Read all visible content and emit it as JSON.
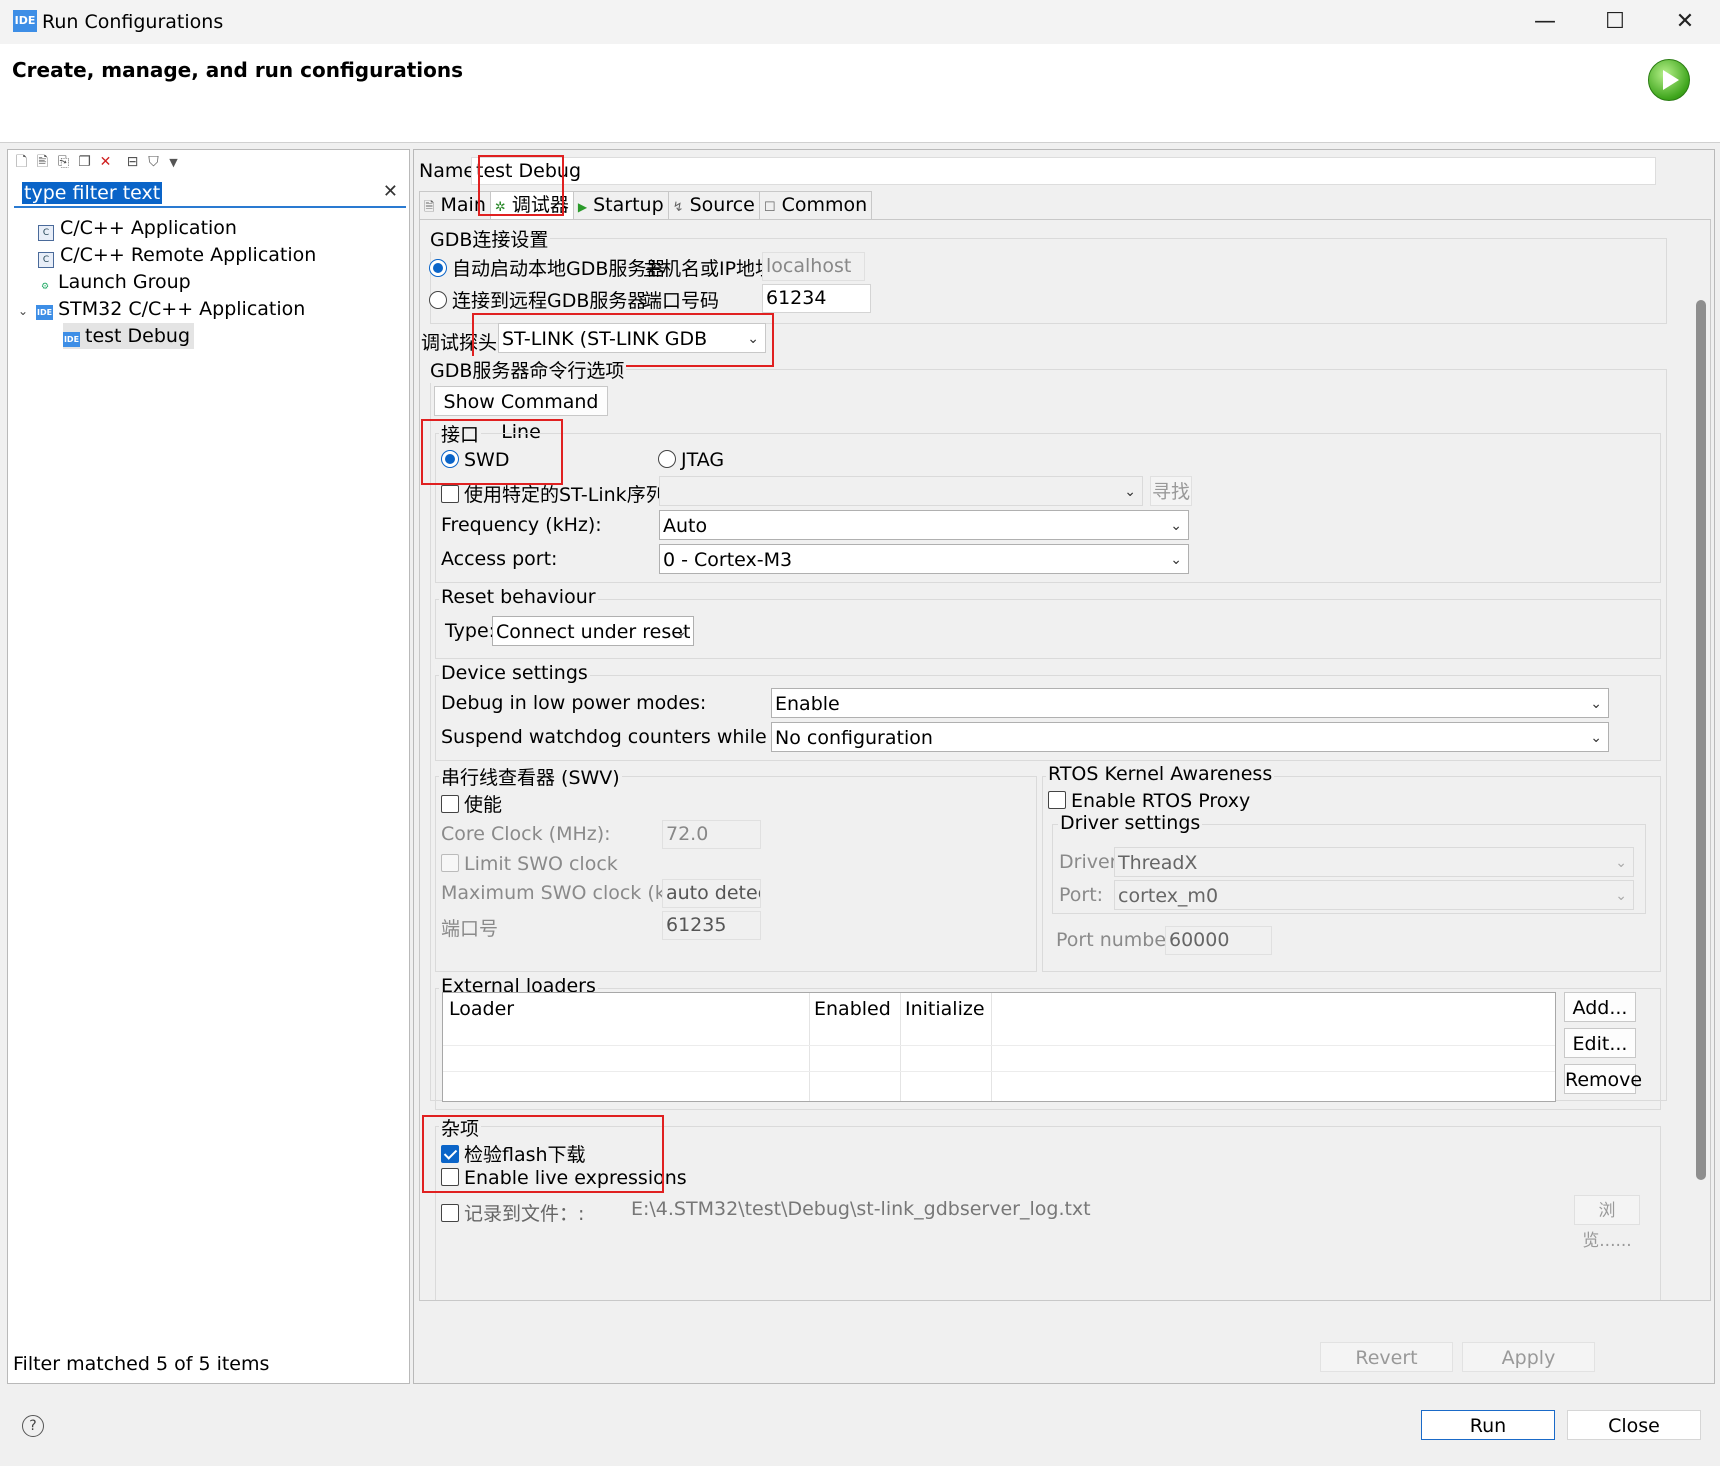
{
  "window": {
    "title": "Run Configurations",
    "icon_text": "IDE",
    "minimize": "—",
    "maximize": "☐",
    "close": "✕"
  },
  "header": {
    "title": "Create, manage, and run configurations"
  },
  "left": {
    "filter_placeholder": "type filter text",
    "tree": [
      {
        "label": "C/C++ Application"
      },
      {
        "label": "C/C++ Remote Application"
      },
      {
        "label": "Launch Group"
      },
      {
        "label": "STM32 C/C++ Application"
      },
      {
        "label": "test Debug"
      }
    ],
    "status": "Filter matched 5 of 5 items"
  },
  "right": {
    "name_label": "Name:",
    "name_value": "test Debug",
    "tabs": [
      {
        "label": "Main"
      },
      {
        "label": "调试器"
      },
      {
        "label": "Startup"
      },
      {
        "label": "Source"
      },
      {
        "label": "Common"
      }
    ],
    "gdb": {
      "group": "GDB连接设置",
      "auto_local": "自动启动本地GDB服务器",
      "host_label": "主机名或IP地址",
      "host_value": "localhost",
      "remote": "连接到远程GDB服务器",
      "port_label": "端口号码",
      "port_value": "61234"
    },
    "probe": {
      "label": "调试探头",
      "value": "ST-LINK (ST-LINK GDB server)"
    },
    "server_opts": {
      "group": "GDB服务器命令行选项",
      "show_cmd": "Show Command Line",
      "iface_group": "接口",
      "swd": "SWD",
      "jtag": "JTAG",
      "serial_chk": "使用特定的ST-Link序列号",
      "find_btn": "寻找",
      "freq_label": "Frequency (kHz):",
      "freq_value": "Auto",
      "ap_label": "Access port:",
      "ap_value": "0 - Cortex-M3"
    },
    "reset": {
      "group": "Reset behaviour",
      "type_label": "Type:",
      "type_value": "Connect under reset"
    },
    "device": {
      "group": "Device settings",
      "lowpower_label": "Debug in low power modes:",
      "lowpower_value": "Enable",
      "watchdog_label": "Suspend watchdog counters while halted:",
      "watchdog_value": "No configuration"
    },
    "swv": {
      "group": "串行线查看器 (SWV)",
      "enable": "使能",
      "core_clock_label": "Core Clock (MHz):",
      "core_clock_value": "72.0",
      "limit_swo": "Limit SWO clock",
      "max_swo_label": "Maximum SWO clock (kHz):",
      "max_swo_value": "auto detect",
      "port_label": "端口号",
      "port_value": "61235"
    },
    "rtos": {
      "group": "RTOS Kernel Awareness",
      "enable_proxy": "Enable RTOS Proxy",
      "driver_group": "Driver settings",
      "driver_label": "Driver:",
      "driver_value": "ThreadX",
      "port_label": "Port:",
      "port_value": "cortex_m0",
      "port_number_label": "Port number:",
      "port_number_value": "60000"
    },
    "loaders": {
      "group": "External loaders",
      "columns": [
        "Loader",
        "Enabled",
        "Initialize"
      ],
      "add": "Add...",
      "edit": "Edit...",
      "remove": "Remove"
    },
    "misc": {
      "group": "杂项",
      "verify_flash": "检验flash下载",
      "live_expr": "Enable live expressions",
      "log_label": "记录到文件：:",
      "log_path": "E:\\4.STM32\\test\\Debug\\st-link_gdbserver_log.txt",
      "browse": "浏览......"
    },
    "revert": "Revert",
    "apply": "Apply"
  },
  "footer": {
    "help": "?",
    "run": "Run",
    "close": "Close"
  }
}
